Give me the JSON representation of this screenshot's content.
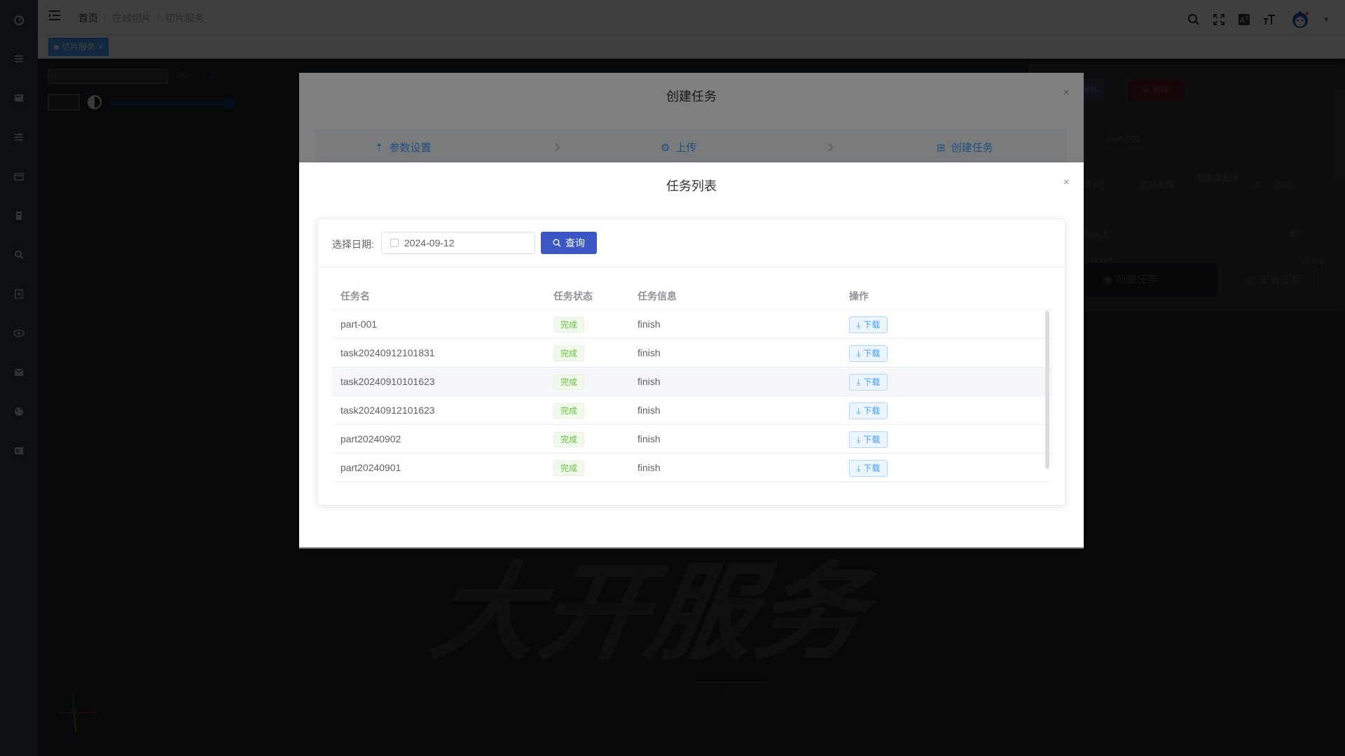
{
  "breadcrumb": {
    "home": "首页",
    "sep": "/",
    "level1": "在线切片",
    "level2": "切片服务"
  },
  "tags": {
    "active": "切片服务",
    "close": "×"
  },
  "background_panel": {
    "add_button": "零件",
    "delete_button": "删除",
    "name_input_value": "part-001",
    "headers": [
      "零件",
      "实体支撑",
      "非实体支撑",
      "点",
      "展示"
    ],
    "row_cell": "hbd_l...",
    "size": "0.000G",
    "version": "V1.2.3",
    "create_button": "创建任务",
    "view_button": "查看任务"
  },
  "background_canvas": {
    "big_text": "大开服务",
    "page_number": "3"
  },
  "create_dialog": {
    "title": "创建任务",
    "close": "×",
    "steps": [
      {
        "label": "参数设置"
      },
      {
        "label": "上传"
      },
      {
        "label": "创建任务"
      }
    ]
  },
  "task_dialog": {
    "title": "任务列表",
    "close": "×",
    "date_label": "选择日期:",
    "date_value": "2024-09-12",
    "query_button": "查询",
    "columns": {
      "name": "任务名",
      "status": "任务状态",
      "info": "任务信息",
      "action": "操作"
    },
    "rows": [
      {
        "name": "part-001",
        "status": "完成",
        "info": "finish",
        "action": "下载"
      },
      {
        "name": "task20240912101831",
        "status": "完成",
        "info": "finish",
        "action": "下载"
      },
      {
        "name": "task20240910101623",
        "status": "完成",
        "info": "finish",
        "action": "下载"
      },
      {
        "name": "task20240912101623",
        "status": "完成",
        "info": "finish",
        "action": "下载"
      },
      {
        "name": "part20240902",
        "status": "完成",
        "info": "finish",
        "action": "下载"
      },
      {
        "name": "part20240901",
        "status": "完成",
        "info": "finish",
        "action": "下载"
      }
    ]
  },
  "colors": {
    "sidebar": "#304156",
    "primary": "#409eff",
    "query_button": "#3c56c4",
    "success": "#67c23a"
  }
}
